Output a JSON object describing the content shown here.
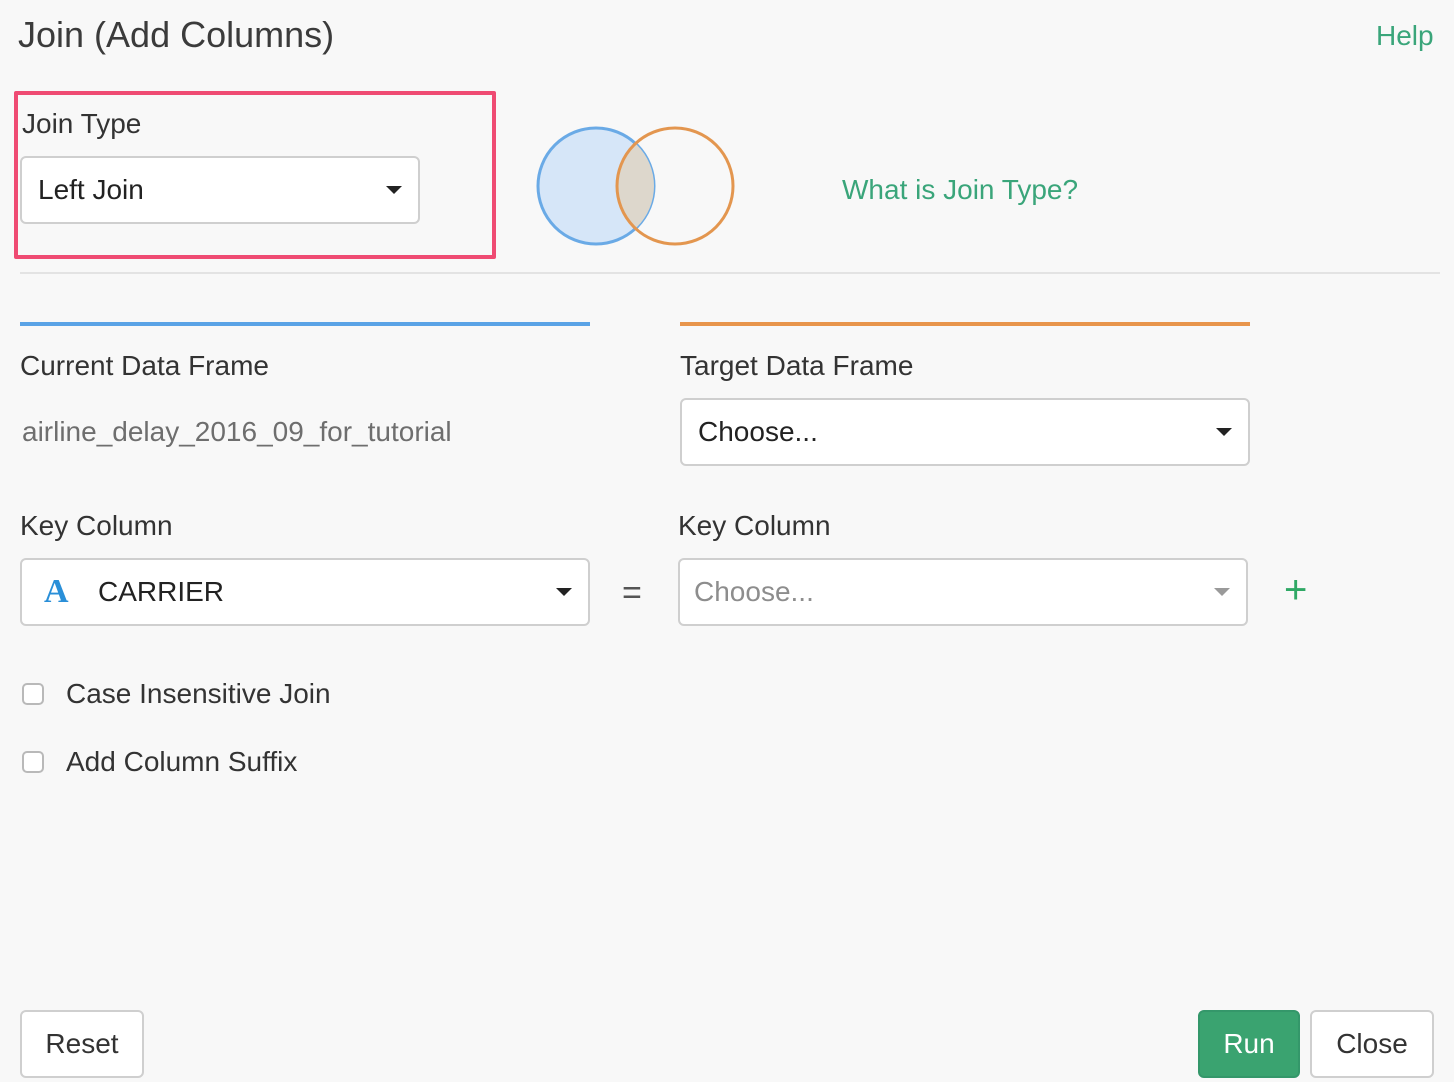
{
  "header": {
    "title": "Join (Add Columns)",
    "help_label": "Help"
  },
  "join_type": {
    "label": "Join Type",
    "selected": "Left Join",
    "info_link": "What is Join Type?"
  },
  "current_frame": {
    "label": "Current Data Frame",
    "value": "airline_delay_2016_09_for_tutorial",
    "key_column_label": "Key Column",
    "key_column_type_icon": "A",
    "key_column_value": "CARRIER"
  },
  "target_frame": {
    "label": "Target Data Frame",
    "selected": "Choose...",
    "key_column_label": "Key Column",
    "key_column_placeholder": "Choose..."
  },
  "operators": {
    "equals": "=",
    "add": "+"
  },
  "options": {
    "case_insensitive_label": "Case Insensitive Join",
    "case_insensitive_checked": false,
    "suffix_label": "Add Column Suffix",
    "suffix_checked": false
  },
  "footer": {
    "reset_label": "Reset",
    "run_label": "Run",
    "close_label": "Close"
  },
  "colors": {
    "accent_green": "#3aa57a",
    "highlight_pink": "#ef4b73",
    "current_blue": "#5aa3e6",
    "target_orange": "#e8954c"
  }
}
